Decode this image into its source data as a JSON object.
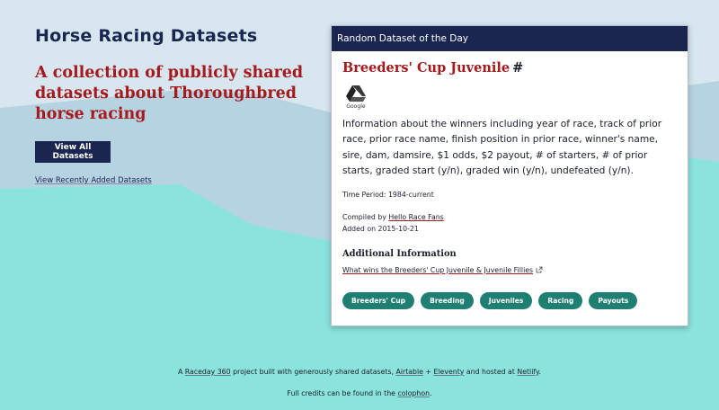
{
  "header": {
    "site_title": "Horse Racing Datasets",
    "tagline": "A collection of publicly shared datasets about Thoroughbred horse racing",
    "view_all_label": "View All Datasets",
    "view_recent_label": "View Recently Added Datasets"
  },
  "card": {
    "header_label": "Random Dataset of the Day",
    "title": "Breeders' Cup Juvenile",
    "anchor": "#",
    "source_icon": "google-drive-icon",
    "source_label": "Google",
    "description": "Information about the winners including year of race, track of prior race, prior race name, finish position in prior race, winner's name, sire, dam, damsire, $1 odds, $2 payout, # of starters, # of prior starts, graded start (y/n), graded win (y/n), undefeated (y/n).",
    "time_period": "Time Period: 1984-current",
    "compiled_prefix": "Compiled by ",
    "compiled_by": "Hello Race Fans",
    "added_on": "Added on 2015-10-21",
    "additional_title": "Additional Information",
    "additional_link": "What wins the Breeders' Cup Juvenile & Juvenile Fillies",
    "tags": [
      "Breeders' Cup",
      "Breeding",
      "Juveniles",
      "Racing",
      "Payouts"
    ]
  },
  "footer": {
    "line1_a": "A ",
    "raceday": "Raceday 360",
    "line1_b": " project built with generously shared datasets, ",
    "airtable": "Airtable",
    "plus": " + ",
    "eleventy": "Eleventy",
    "line1_c": " and hosted at ",
    "netlify": "Netlify",
    "line1_d": ".",
    "line2_a": "Full credits can be found in the ",
    "colophon": "colophon",
    "line2_b": "."
  },
  "colors": {
    "navy": "#1a2550",
    "red": "#a6191c",
    "teal": "#1f7f72",
    "sky": "#d7e6ef",
    "hill": "#b6d3e2",
    "ground": "#8ae3dc"
  }
}
